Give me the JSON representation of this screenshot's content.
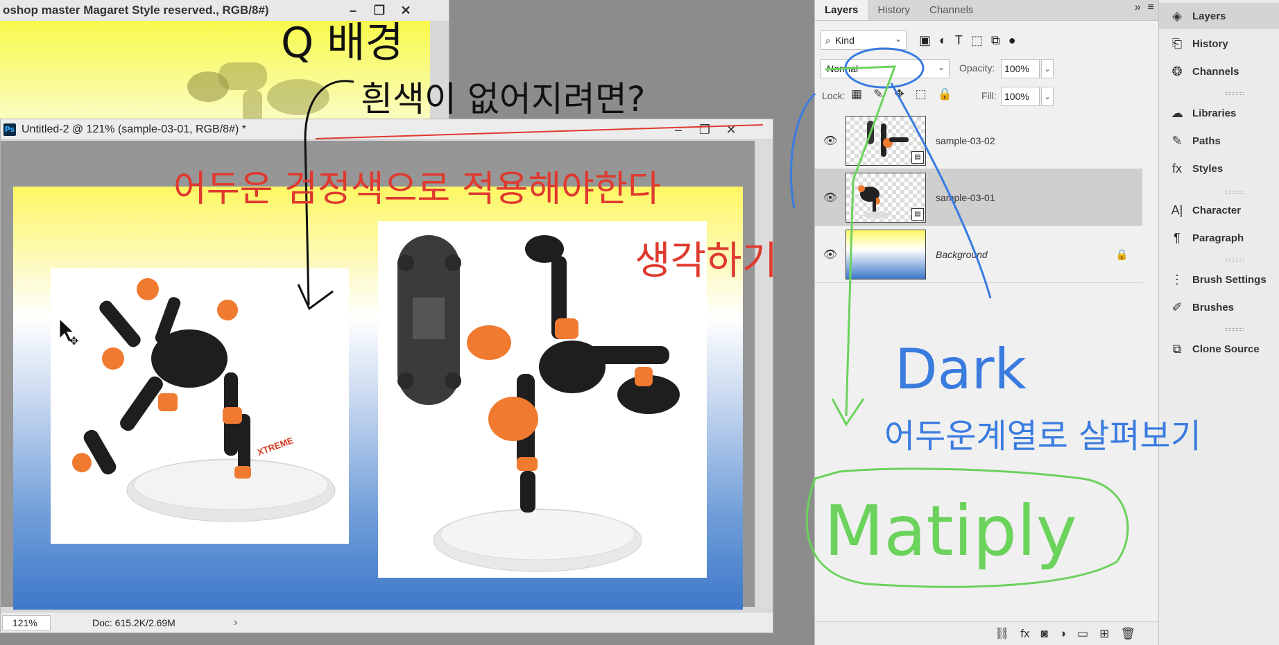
{
  "back_window": {
    "title": "oshop master Magaret Style reserved., RGB/8#)",
    "btn_minimize": "–",
    "btn_restore": "❐",
    "btn_close": "✕"
  },
  "front_window": {
    "app_badge": "Ps",
    "title": "Untitled-2 @ 121% (sample-03-01, RGB/8#) *",
    "btn_minimize": "–",
    "btn_restore": "❐",
    "btn_close": "✕",
    "status": {
      "zoom": "121%",
      "doc_info": "Doc: 615.2K/2.69M",
      "arrow": "›"
    }
  },
  "layers_panel": {
    "tabs": [
      "Layers",
      "History",
      "Channels"
    ],
    "tab_expand": "»",
    "tab_menu": "≡",
    "filter": {
      "label": "Kind",
      "search_icon": "⌕",
      "caret": "⌄"
    },
    "filter_icons": [
      "▣",
      "◐",
      "T",
      "⬚",
      "⧉",
      "●"
    ],
    "blend_mode": "Normal",
    "opacity_label": "Opacity:",
    "opacity_value": "100%",
    "lock_label": "Lock:",
    "lock_icons": [
      "▦",
      "✎",
      "✥",
      "⬚",
      "🔒"
    ],
    "fill_label": "Fill:",
    "fill_value": "100%",
    "dropdown_caret": "⌄",
    "eye_icon": "👁",
    "smart_badge": "▤",
    "layers": [
      {
        "name": "sample-03-02",
        "selected": false
      },
      {
        "name": "sample-03-01",
        "selected": true
      },
      {
        "name": "Background",
        "selected": false,
        "locked": true
      }
    ],
    "bottom_icons": [
      "⛓",
      "fx",
      "◙",
      "◑",
      "▭",
      "⊞",
      "🗑"
    ]
  },
  "side_strip": {
    "items": [
      {
        "label": "Layers",
        "icon": "◈"
      },
      {
        "label": "History",
        "icon": "⎗"
      },
      {
        "label": "Channels",
        "icon": "❂"
      },
      {
        "label": "Libraries",
        "icon": "☁"
      },
      {
        "label": "Paths",
        "icon": "✎"
      },
      {
        "label": "Styles",
        "icon": "fx"
      },
      {
        "label": "Character",
        "icon": "A|"
      },
      {
        "label": "Paragraph",
        "icon": "¶"
      },
      {
        "label": "Brush Settings",
        "icon": "⋮"
      },
      {
        "label": "Brushes",
        "icon": "✐"
      },
      {
        "label": "Clone Source",
        "icon": "⧉"
      }
    ]
  },
  "annotations": {
    "q_title": "Q 배경",
    "q_line2": "흰색이 없어지려면?",
    "red_note1": "어두운 검정색으로 적용해야한다",
    "red_note2": "생각하기",
    "blue_title": "Dark",
    "blue_note": "어두운계열로 살펴보기",
    "green_note": "Matiply"
  },
  "colors": {
    "annot_black": "#111111",
    "annot_red": "#e0392f",
    "annot_blue": "#3a7be0",
    "annot_green": "#6bd25c"
  }
}
